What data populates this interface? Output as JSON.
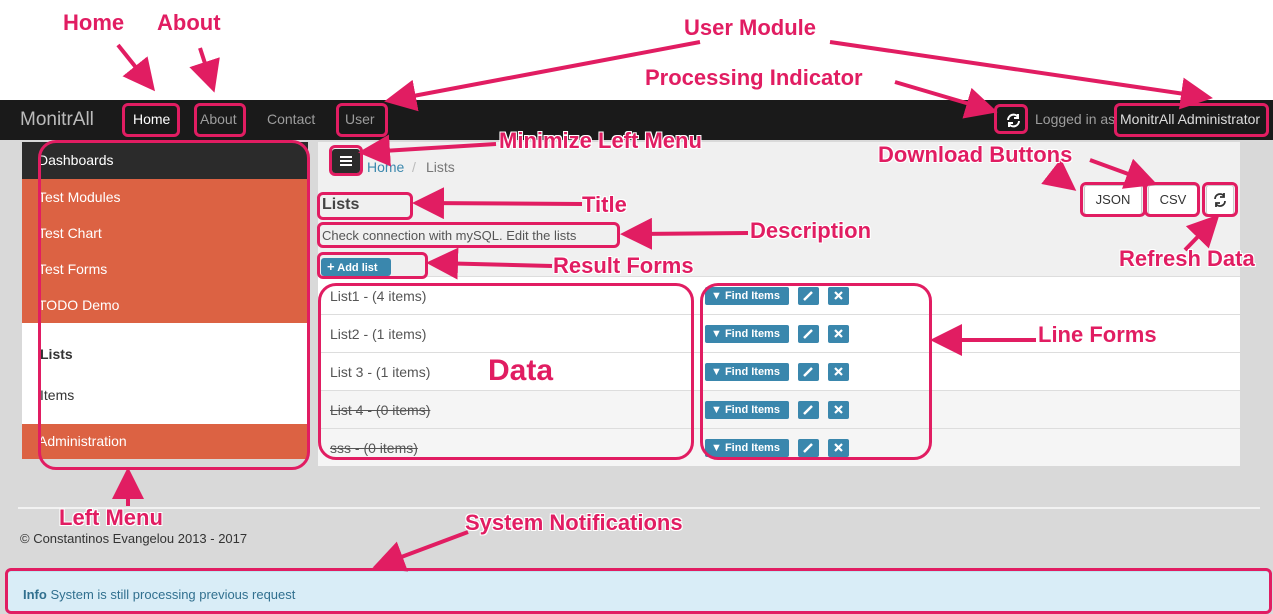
{
  "nav": {
    "brand": "MonitrAll",
    "links": [
      "Home",
      "About",
      "Contact",
      "User"
    ],
    "login_text": "Logged in as",
    "login_user": "MonitrAll Administrator"
  },
  "sidebar": {
    "dashboards": "Dashboards",
    "items": [
      "Test Modules",
      "Test Chart",
      "Test Forms",
      "TODO Demo"
    ],
    "sub_items": [
      "Lists",
      "Items"
    ],
    "administration": "Administration"
  },
  "breadcrumb": {
    "home": "Home",
    "separator": "/",
    "current": "Lists"
  },
  "main": {
    "title": "Lists",
    "description": "Check connection with mySQL. Edit the lists",
    "add_button": "Add list",
    "download": [
      "JSON",
      "CSV"
    ],
    "find_label": "Find Items",
    "rows": [
      {
        "label": "List1 - (4 items)",
        "strike": false
      },
      {
        "label": "List2 - (1 items)",
        "strike": false
      },
      {
        "label": "List 3 - (1 items)",
        "strike": false
      },
      {
        "label": "List 4 - (0 items)",
        "strike": true
      },
      {
        "label": "sss - (0 items)",
        "strike": true
      }
    ]
  },
  "footer": {
    "copyright": "© Constantinos Evangelou 2013 - 2017",
    "alert_label": "Info",
    "alert_text": "System is still processing previous request"
  },
  "annotations": {
    "home": "Home",
    "about": "About",
    "user_module": "User Module",
    "processing": "Processing Indicator",
    "minimize": "Minimize Left Menu",
    "download": "Download Buttons",
    "title": "Title",
    "description": "Description",
    "result_forms": "Result Forms",
    "refresh": "Refresh Data",
    "line_forms": "Line Forms",
    "data": "Data",
    "left_menu": "Left Menu",
    "notifications": "System Notifications"
  },
  "colors": {
    "accent": "#e11d62",
    "menu_orange": "#dc6243",
    "button_blue": "#3a87ad",
    "navbar": "#1a1a1a"
  },
  "icons": [
    "refresh-icon",
    "menu-icon",
    "plus-icon",
    "filter-icon",
    "pencil-icon",
    "close-icon"
  ]
}
